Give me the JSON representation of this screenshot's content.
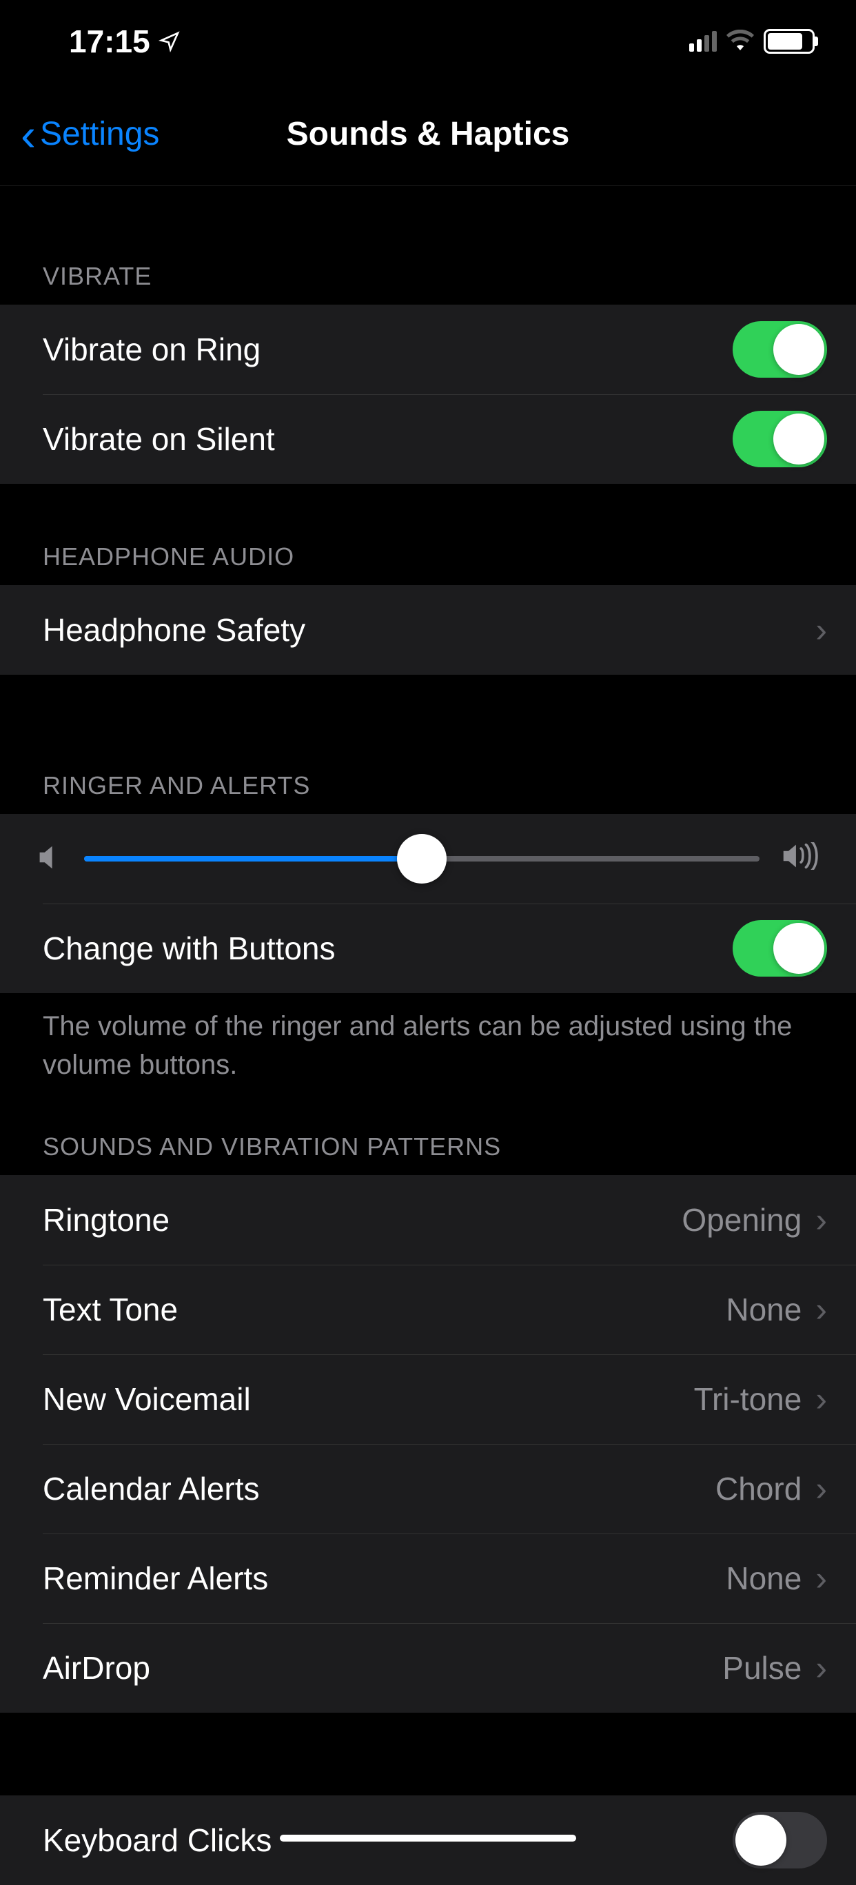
{
  "statusBar": {
    "time": "17:15"
  },
  "nav": {
    "back": "Settings",
    "title": "Sounds & Haptics"
  },
  "sections": {
    "vibrate": {
      "header": "Vibrate",
      "rows": [
        {
          "label": "Vibrate on Ring",
          "on": true
        },
        {
          "label": "Vibrate on Silent",
          "on": true
        }
      ]
    },
    "headphoneAudio": {
      "header": "Headphone Audio",
      "rows": [
        {
          "label": "Headphone Safety"
        }
      ]
    },
    "ringerAlerts": {
      "header": "Ringer and Alerts",
      "volume": 50,
      "changeWithButtons": {
        "label": "Change with Buttons",
        "on": true
      },
      "footer": "The volume of the ringer and alerts can be adjusted using the volume buttons."
    },
    "soundsPatterns": {
      "header": "Sounds and Vibration Patterns",
      "rows": [
        {
          "label": "Ringtone",
          "value": "Opening"
        },
        {
          "label": "Text Tone",
          "value": "None"
        },
        {
          "label": "New Voicemail",
          "value": "Tri-tone"
        },
        {
          "label": "Calendar Alerts",
          "value": "Chord"
        },
        {
          "label": "Reminder Alerts",
          "value": "None"
        },
        {
          "label": "AirDrop",
          "value": "Pulse"
        }
      ]
    },
    "keyboard": {
      "rows": [
        {
          "label": "Keyboard Clicks",
          "on": false
        }
      ]
    }
  }
}
